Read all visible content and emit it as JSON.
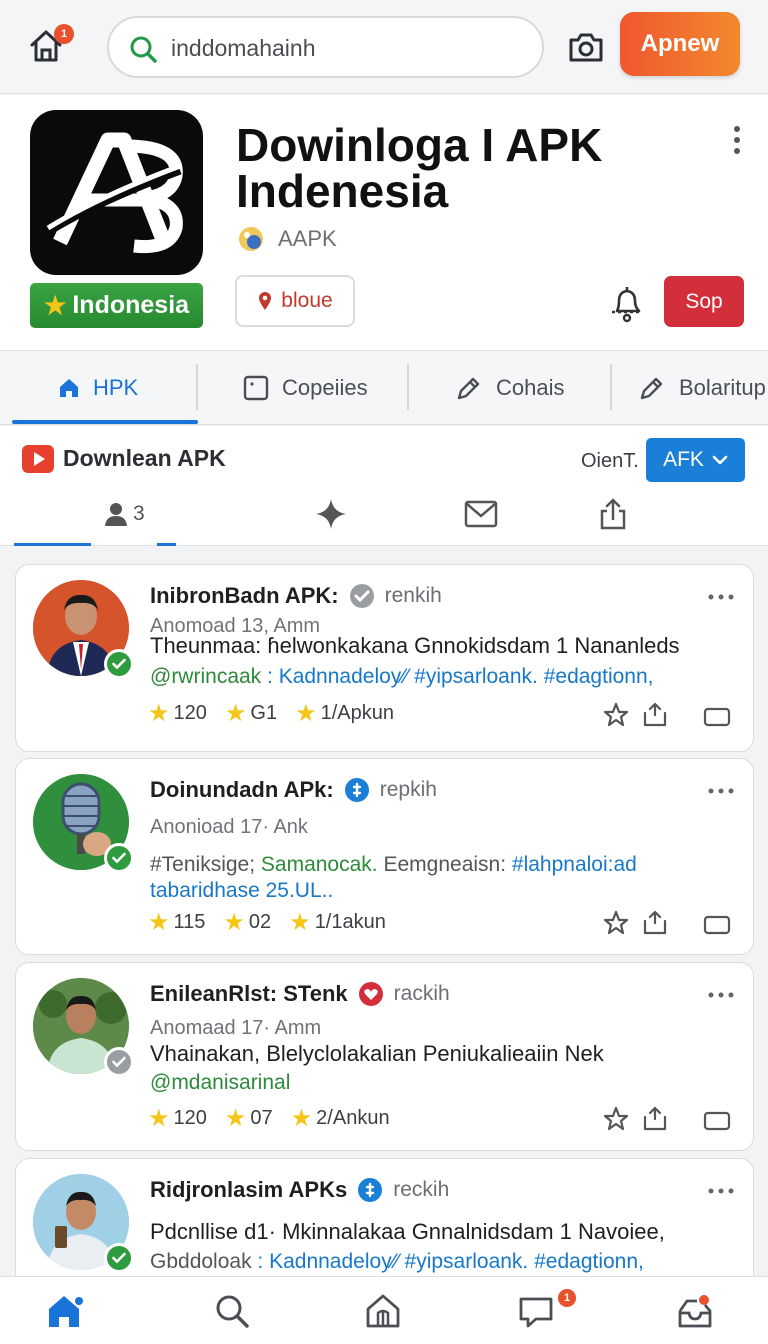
{
  "topbar": {
    "home_badge": "1",
    "search_value": "inddomahainh",
    "apnew_label": "Apnew"
  },
  "header": {
    "title": "Dowinloga I APK Indenesia",
    "country_label": "Indonesia",
    "developer": "AAPK",
    "bloue_label": "bloue",
    "sop_label": "Sop"
  },
  "tabs": [
    {
      "label": "ΗPK",
      "icon": "home-icon"
    },
    {
      "label": "Copeiies",
      "icon": "square-icon"
    },
    {
      "label": "Cohais",
      "icon": "pen-icon"
    },
    {
      "label": "Bolaritup",
      "icon": "pen-icon"
    }
  ],
  "subheader": {
    "title": "Downlean APK",
    "orient_label": "OienT.",
    "afk_label": "AFK",
    "user_count": "3"
  },
  "posts": [
    {
      "name": "InibronBadn APK:",
      "handle": "renkih",
      "time": "Anomoad 13, Amm",
      "text": "Theunmaa: ɦelwonkakana Gnnokidsdam 1 Nananleds",
      "tags_a": "@rwrincaak",
      "tags_b": " : Kadnnadeloy⁄⁄ #yipsarloank. #edagtionn,",
      "stat1": "120",
      "stat2": "G1",
      "stat3": "1/Apkun",
      "verified_color": "#2e9b3e"
    },
    {
      "name": "Doinundadn APk:",
      "handle": "repkih",
      "time": "Anonioad 17· Ank",
      "tags_a": "#Teniksige;",
      "tags_b": " Samanocak.",
      "tags_c": " Eemgneaisn:",
      "tags_d": " #lahpnaloi:ad",
      "tags_line2": "tabaridhase 25.UL..",
      "stat1": "115",
      "stat2": "02",
      "stat3": "1/1akun",
      "verified_color": "#2e9b3e"
    },
    {
      "name": "EnileanRlst: STenk",
      "handle": "rackih",
      "time": "Anomaad 17· Amm",
      "text": "Vhainakan, Blelyclolakalian Peniukalieaiin Nek",
      "tags_a": "@mdanisarinal",
      "stat1": "120",
      "stat2": "07",
      "stat3": "2/Ankun",
      "verified_color": "#9a9ea3"
    },
    {
      "name": "Ridjronlasim APKs",
      "handle": "reckih",
      "text": "Pdcnllise d1· Mkinnalakaa Gnnalnidsdam 1 Navoiee,",
      "tags_a": "Gbddoloak",
      "tags_b": " : Kadnnadeloy⁄⁄ #yipsarloank. #edagtionn,",
      "verified_color": "#2e9b3e"
    }
  ],
  "bottomnav": {
    "chat_badge": "1"
  },
  "colors": {
    "accent": "#1a73d9",
    "orange": "#f0572f",
    "red": "#d32f3b",
    "green": "#2e9b3e"
  }
}
